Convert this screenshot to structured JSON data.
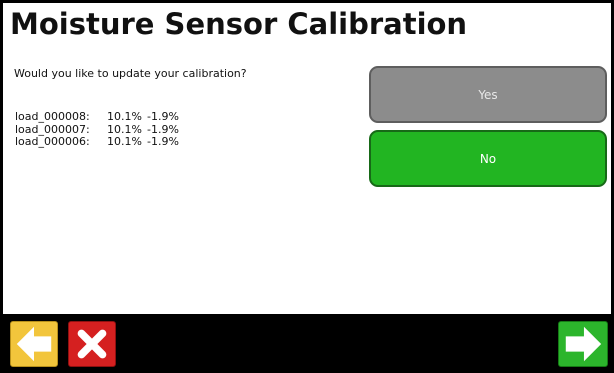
{
  "header": {
    "title": "Moisture Sensor Calibration"
  },
  "prompt": "Would you like to update your calibration?",
  "loads": [
    {
      "name": "load_000008:",
      "value1": "10.1%",
      "value2": "-1.9%"
    },
    {
      "name": "load_000007:",
      "value1": "10.1%",
      "value2": "-1.9%"
    },
    {
      "name": "load_000006:",
      "value1": "10.1%",
      "value2": "-1.9%"
    }
  ],
  "buttons": {
    "yes_label": "Yes",
    "no_label": "No"
  },
  "footer": {
    "back_icon": "arrow-left-icon",
    "cancel_icon": "close-icon",
    "next_icon": "arrow-right-icon"
  },
  "colors": {
    "yes_button": "#8c8c8c",
    "no_button": "#22b522",
    "back_button": "#f2c53c",
    "cancel_button": "#d52020",
    "next_button": "#2cb52c"
  }
}
